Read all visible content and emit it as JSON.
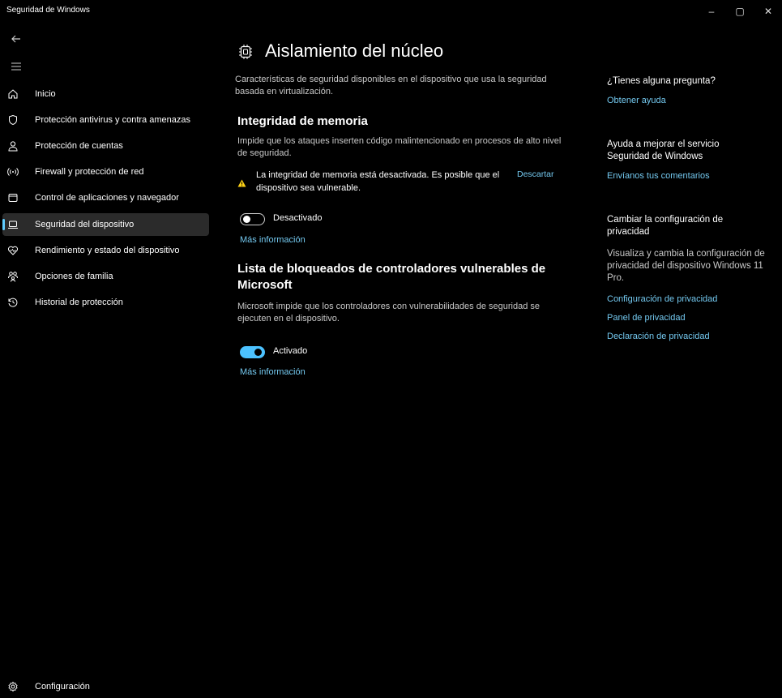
{
  "window": {
    "title": "Seguridad de Windows",
    "controls": [
      "–",
      "▢",
      "✕"
    ]
  },
  "sidebar": {
    "items": [
      {
        "label": "Inicio",
        "icon": "home-icon"
      },
      {
        "label": "Protección antivirus y contra amenazas",
        "icon": "shield-icon"
      },
      {
        "label": "Protección de cuentas",
        "icon": "person-icon"
      },
      {
        "label": "Firewall y protección de red",
        "icon": "wifi-antenna-icon"
      },
      {
        "label": "Control de aplicaciones y navegador",
        "icon": "app-window-icon"
      },
      {
        "label": "Seguridad del dispositivo",
        "icon": "laptop-icon",
        "active": true
      },
      {
        "label": "Rendimiento y estado del dispositivo",
        "icon": "heart-icon"
      },
      {
        "label": "Opciones de familia",
        "icon": "family-icon"
      },
      {
        "label": "Historial de protección",
        "icon": "history-icon"
      }
    ],
    "settings_label": "Configuración"
  },
  "main": {
    "title": "Aislamiento del núcleo",
    "description": "Características de seguridad disponibles en el dispositivo que usa la seguridad basada en virtualización.",
    "memory_integrity": {
      "heading": "Integridad de memoria",
      "description": "Impide que los ataques inserten código malintencionado en procesos de alto nivel de seguridad.",
      "warning": "La integridad de memoria está desactivada. Es posible que el dispositivo sea vulnerable.",
      "dismiss_label": "Descartar",
      "toggle_state": "Desactivado",
      "more_info": "Más información"
    },
    "blocklist": {
      "heading": "Lista de bloqueados de controladores vulnerables de Microsoft",
      "description": "Microsoft impide que los controladores con vulnerabilidades de seguridad se ejecuten en el dispositivo.",
      "toggle_state": "Activado",
      "more_info": "Más información"
    }
  },
  "right": {
    "question_heading": "¿Tienes alguna pregunta?",
    "get_help": "Obtener ayuda",
    "improve_heading": "Ayuda a mejorar el servicio Seguridad de Windows",
    "feedback": "Envíanos tus comentarios",
    "privacy_heading": "Cambiar la configuración de privacidad",
    "privacy_body": "Visualiza y cambia la configuración de privacidad del dispositivo Windows 11 Pro.",
    "privacy_links": [
      "Configuración de privacidad",
      "Panel de privacidad",
      "Declaración de privacidad"
    ]
  },
  "colors": {
    "accent": "#4cc2ff",
    "link": "#74c9f0",
    "warning": "#fcd116",
    "background": "#000000"
  }
}
